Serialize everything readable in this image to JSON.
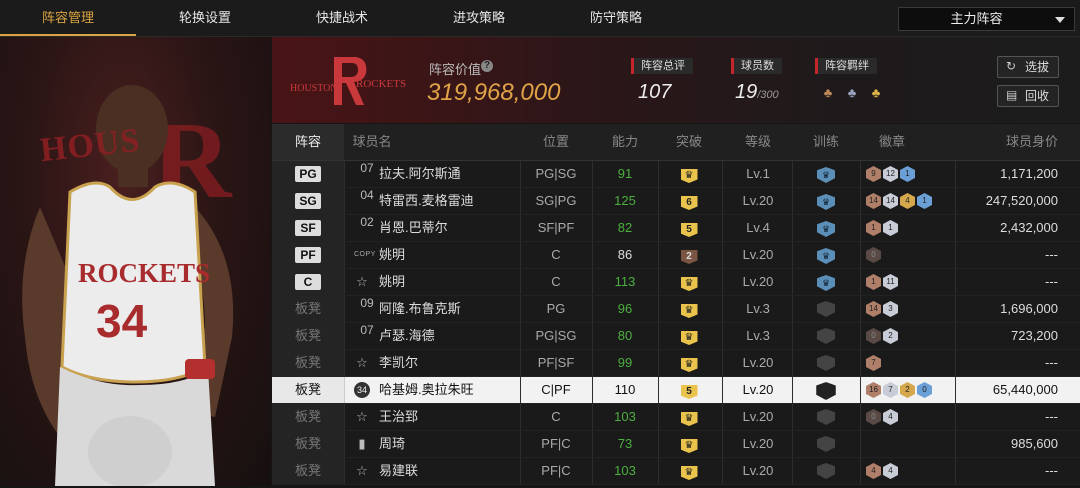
{
  "nav": {
    "tabs": [
      {
        "label": "阵容管理",
        "active": true
      },
      {
        "label": "轮换设置",
        "active": false
      },
      {
        "label": "快捷战术",
        "active": false
      },
      {
        "label": "进攻策略",
        "active": false
      },
      {
        "label": "防守策略",
        "active": false
      }
    ],
    "lineup_select": "主力阵容"
  },
  "team": {
    "logo_text_left": "HOUSTON",
    "logo_text_right": "ROCKETS",
    "value_label": "阵容价值",
    "value": "319,968,000",
    "overall_label": "阵容总评",
    "overall": "107",
    "players_label": "球员数",
    "players": "19",
    "players_max": "/300",
    "bond_label": "阵容羁绊"
  },
  "buttons": {
    "select": "选拔",
    "recycle": "回收"
  },
  "columns": [
    "阵容",
    "球员名",
    "位置",
    "能力",
    "突破",
    "等级",
    "训练",
    "徽章",
    "球员身价"
  ],
  "rows": [
    {
      "slot": "PG",
      "starter": true,
      "num": "07",
      "name": "拉夫.阿尔斯通",
      "position": "PG|SG",
      "ability": "91",
      "ability_color": "#4caf3f",
      "breakthrough": "",
      "level": "Lv.1",
      "training": "1",
      "badges": [
        [
          "br",
          "9"
        ],
        [
          "si",
          "12"
        ],
        [
          "bl",
          "1"
        ]
      ],
      "worth": "1,171,200"
    },
    {
      "slot": "SG",
      "starter": true,
      "num": "04",
      "name": "特雷西.麦格雷迪",
      "position": "SG|PG",
      "ability": "125",
      "ability_color": "#4caf3f",
      "breakthrough": "6",
      "level": "Lv.20",
      "training": "1",
      "badges": [
        [
          "br",
          "14"
        ],
        [
          "si",
          "14"
        ],
        [
          "go",
          "4"
        ],
        [
          "bl",
          "1"
        ]
      ],
      "worth": "247,520,000"
    },
    {
      "slot": "SF",
      "starter": true,
      "num": "02",
      "name": "肖恩.巴蒂尔",
      "position": "SF|PF",
      "ability": "82",
      "ability_color": "#4caf3f",
      "breakthrough": "5",
      "level": "Lv.4",
      "training": "1",
      "badges": [
        [
          "br",
          "1"
        ],
        [
          "si",
          "1"
        ]
      ],
      "worth": "2,432,000"
    },
    {
      "slot": "PF",
      "starter": true,
      "num": "COPY",
      "name": "姚明",
      "position": "C",
      "ability": "86",
      "ability_color": "#dddddd",
      "breakthrough": "2",
      "breakthrough_dark": true,
      "level": "Lv.20",
      "training": "1",
      "badges": [
        [
          "dk",
          "0"
        ]
      ],
      "worth": "---"
    },
    {
      "slot": "C",
      "starter": true,
      "num": "☆",
      "name": "姚明",
      "position": "C",
      "ability": "113",
      "ability_color": "#4caf3f",
      "breakthrough": "",
      "level": "Lv.20",
      "training": "1",
      "badges": [
        [
          "br",
          "1"
        ],
        [
          "si",
          "11"
        ]
      ],
      "worth": "---"
    },
    {
      "slot": "板凳",
      "starter": false,
      "num": "09",
      "name": "阿隆.布鲁克斯",
      "position": "PG",
      "ability": "96",
      "ability_color": "#4caf3f",
      "breakthrough": "",
      "level": "Lv.3",
      "training": "0",
      "badges": [
        [
          "br",
          "14"
        ],
        [
          "si",
          "3"
        ]
      ],
      "worth": "1,696,000"
    },
    {
      "slot": "板凳",
      "starter": false,
      "num": "07",
      "name": "卢瑟.海德",
      "position": "PG|SG",
      "ability": "80",
      "ability_color": "#4caf3f",
      "breakthrough": "",
      "level": "Lv.3",
      "training": "0",
      "badges": [
        [
          "dk",
          "0"
        ],
        [
          "si",
          "2"
        ]
      ],
      "worth": "723,200"
    },
    {
      "slot": "板凳",
      "starter": false,
      "num": "☆",
      "name": "李凯尔",
      "position": "PF|SF",
      "ability": "99",
      "ability_color": "#4caf3f",
      "breakthrough": "",
      "level": "Lv.20",
      "training": "0",
      "badges": [
        [
          "br",
          "7"
        ]
      ],
      "worth": "---"
    },
    {
      "slot": "板凳",
      "starter": false,
      "selected": true,
      "num": "34",
      "name": "哈基姆.奥拉朱旺",
      "position": "C|PF",
      "ability": "110",
      "ability_color": "#111111",
      "breakthrough": "5",
      "level": "Lv.20",
      "training": "black",
      "badges": [
        [
          "br",
          "16"
        ],
        [
          "si",
          "7"
        ],
        [
          "go",
          "2"
        ],
        [
          "bl",
          "0"
        ]
      ],
      "worth": "65,440,000"
    },
    {
      "slot": "板凳",
      "starter": false,
      "num": "☆",
      "name": "王治郅",
      "position": "C",
      "ability": "103",
      "ability_color": "#4caf3f",
      "breakthrough": "",
      "level": "Lv.20",
      "training": "0",
      "badges": [
        [
          "dk",
          "0"
        ],
        [
          "si",
          "4"
        ]
      ],
      "worth": "---"
    },
    {
      "slot": "板凳",
      "starter": false,
      "num": "bars",
      "name": "周琦",
      "position": "PF|C",
      "ability": "73",
      "ability_color": "#4caf3f",
      "breakthrough": "",
      "level": "Lv.20",
      "training": "0",
      "badges": [],
      "worth": "985,600"
    },
    {
      "slot": "板凳",
      "starter": false,
      "num": "☆",
      "name": "易建联",
      "position": "PF|C",
      "ability": "103",
      "ability_color": "#4caf3f",
      "breakthrough": "",
      "level": "Lv.20",
      "training": "0",
      "badges": [
        [
          "br",
          "4"
        ],
        [
          "si",
          "4"
        ]
      ],
      "worth": "---"
    }
  ]
}
